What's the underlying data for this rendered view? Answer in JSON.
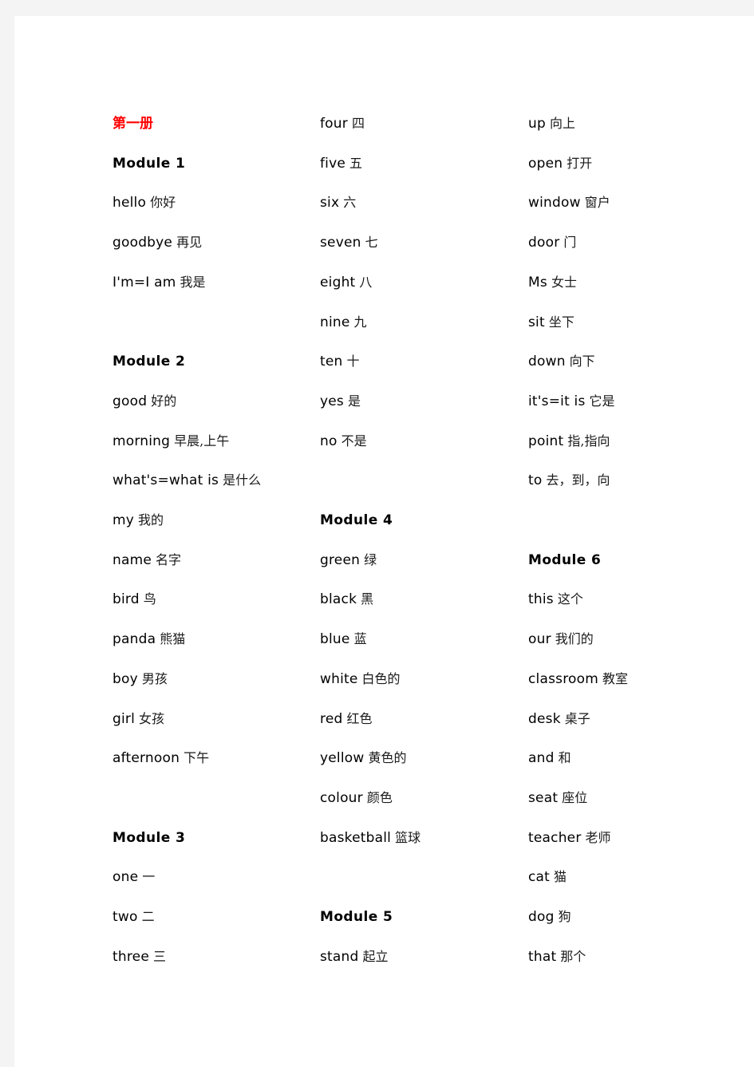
{
  "page": {
    "title": "第一册",
    "background_color": "#ffffff",
    "margin_color": "#f4f4f4",
    "title_color": "#ff0000"
  },
  "columns": [
    {
      "id": "column-1",
      "rows": [
        {
          "type": "doc-title",
          "en": "第一册",
          "zh": ""
        },
        {
          "type": "module",
          "en": "Module 1",
          "zh": ""
        },
        {
          "type": "entry",
          "en": "hello",
          "zh": "你好"
        },
        {
          "type": "entry",
          "en": "goodbye",
          "zh": "再见"
        },
        {
          "type": "entry",
          "en": "I'm=I am",
          "zh": "我是"
        },
        {
          "type": "blank",
          "en": "",
          "zh": ""
        },
        {
          "type": "module",
          "en": "Module 2",
          "zh": ""
        },
        {
          "type": "entry",
          "en": "good",
          "zh": "好的"
        },
        {
          "type": "entry",
          "en": "morning",
          "zh": "早晨,上午"
        },
        {
          "type": "entry",
          "en": "what's=what is",
          "zh": "是什么"
        },
        {
          "type": "entry",
          "en": "my",
          "zh": "我的"
        },
        {
          "type": "entry",
          "en": "name",
          "zh": "名字"
        },
        {
          "type": "entry",
          "en": "bird",
          "zh": "鸟"
        },
        {
          "type": "entry",
          "en": "panda",
          "zh": "熊猫"
        },
        {
          "type": "entry",
          "en": "boy",
          "zh": "男孩"
        },
        {
          "type": "entry",
          "en": "girl",
          "zh": "女孩"
        },
        {
          "type": "entry",
          "en": "afternoon",
          "zh": "下午"
        },
        {
          "type": "blank",
          "en": "",
          "zh": ""
        },
        {
          "type": "module",
          "en": "Module 3",
          "zh": ""
        },
        {
          "type": "entry",
          "en": "one",
          "zh": "一"
        },
        {
          "type": "entry",
          "en": "two",
          "zh": "二"
        },
        {
          "type": "entry",
          "en": "three",
          "zh": "三"
        }
      ]
    },
    {
      "id": "column-2",
      "rows": [
        {
          "type": "entry",
          "en": "four",
          "zh": "四"
        },
        {
          "type": "entry",
          "en": "five",
          "zh": "五"
        },
        {
          "type": "entry",
          "en": "six",
          "zh": "六"
        },
        {
          "type": "entry",
          "en": "seven",
          "zh": "七"
        },
        {
          "type": "entry",
          "en": "eight",
          "zh": "八"
        },
        {
          "type": "entry",
          "en": "nine",
          "zh": "九"
        },
        {
          "type": "entry",
          "en": "ten",
          "zh": "十"
        },
        {
          "type": "entry",
          "en": "yes",
          "zh": "是"
        },
        {
          "type": "entry",
          "en": "no",
          "zh": "不是"
        },
        {
          "type": "blank",
          "en": "",
          "zh": ""
        },
        {
          "type": "module",
          "en": "Module 4",
          "zh": ""
        },
        {
          "type": "entry",
          "en": "green",
          "zh": "绿"
        },
        {
          "type": "entry",
          "en": "black",
          "zh": "黑"
        },
        {
          "type": "entry",
          "en": "blue",
          "zh": "蓝"
        },
        {
          "type": "entry",
          "en": "white",
          "zh": "白色的"
        },
        {
          "type": "entry",
          "en": "red",
          "zh": "红色"
        },
        {
          "type": "entry",
          "en": "yellow",
          "zh": "黄色的"
        },
        {
          "type": "entry",
          "en": "colour",
          "zh": "颜色"
        },
        {
          "type": "entry",
          "en": "basketball",
          "zh": "篮球"
        },
        {
          "type": "blank",
          "en": "",
          "zh": ""
        },
        {
          "type": "module",
          "en": "Module 5",
          "zh": ""
        },
        {
          "type": "entry",
          "en": "stand",
          "zh": "起立"
        }
      ]
    },
    {
      "id": "column-3",
      "rows": [
        {
          "type": "entry",
          "en": "up",
          "zh": "向上"
        },
        {
          "type": "entry",
          "en": "open",
          "zh": "打开"
        },
        {
          "type": "entry",
          "en": "window",
          "zh": "窗户"
        },
        {
          "type": "entry",
          "en": "door",
          "zh": "门"
        },
        {
          "type": "entry",
          "en": "Ms",
          "zh": "女士"
        },
        {
          "type": "entry",
          "en": "sit",
          "zh": "坐下"
        },
        {
          "type": "entry",
          "en": "down",
          "zh": "向下"
        },
        {
          "type": "entry",
          "en": "it's=it is",
          "zh": "它是"
        },
        {
          "type": "entry",
          "en": "point",
          "zh": "指,指向"
        },
        {
          "type": "entry",
          "en": "to",
          "zh": "去，到，向"
        },
        {
          "type": "blank",
          "en": "",
          "zh": ""
        },
        {
          "type": "module",
          "en": "Module 6",
          "zh": ""
        },
        {
          "type": "entry",
          "en": "this",
          "zh": "这个"
        },
        {
          "type": "entry",
          "en": "our",
          "zh": "我们的"
        },
        {
          "type": "entry",
          "en": "classroom",
          "zh": "教室"
        },
        {
          "type": "entry",
          "en": "desk",
          "zh": "桌子"
        },
        {
          "type": "entry",
          "en": "and",
          "zh": "和"
        },
        {
          "type": "entry",
          "en": "seat",
          "zh": "座位"
        },
        {
          "type": "entry",
          "en": "teacher",
          "zh": "老师"
        },
        {
          "type": "entry",
          "en": "cat",
          "zh": "猫"
        },
        {
          "type": "entry",
          "en": "dog",
          "zh": "狗"
        },
        {
          "type": "entry",
          "en": "that",
          "zh": "那个"
        }
      ]
    }
  ]
}
